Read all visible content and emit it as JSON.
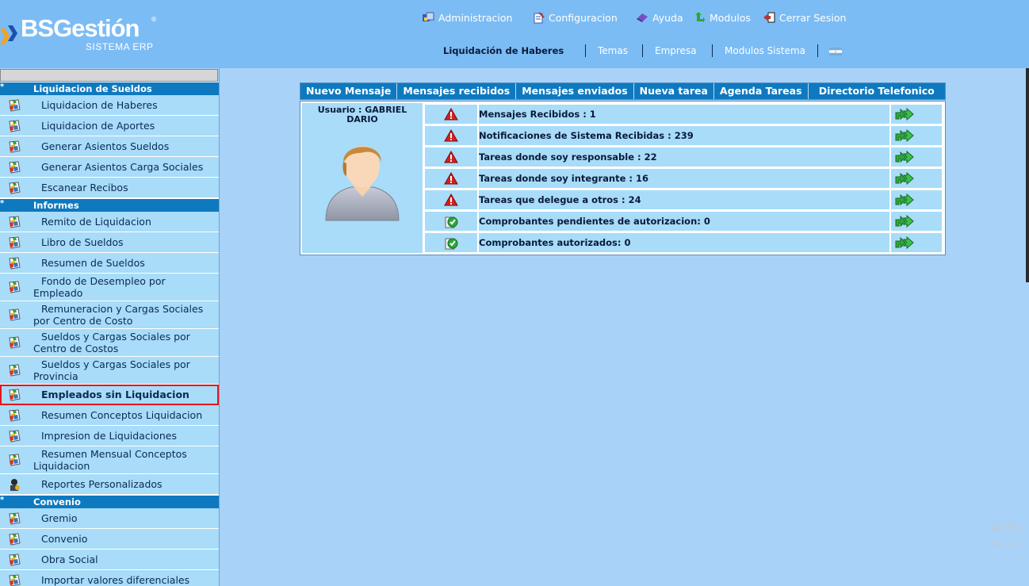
{
  "logo": {
    "brand": "BSGestión",
    "reg": "®",
    "subtitle": "SISTEMA ERP"
  },
  "topnav": [
    {
      "label": "Administracion",
      "icon": "admin-icon"
    },
    {
      "label": "Configuracion",
      "icon": "config-icon"
    },
    {
      "label": "Ayuda",
      "icon": "help-icon"
    },
    {
      "label": "Modulos",
      "icon": "modules-icon"
    },
    {
      "label": "Cerrar Sesion",
      "icon": "logout-icon"
    }
  ],
  "secnav": {
    "current": "Liquidación de Haberes",
    "links": [
      "Temas",
      "Empresa",
      "Modulos Sistema"
    ],
    "flag": "argentina-flag-icon"
  },
  "sidebar": {
    "sections": [
      {
        "title": "Liquidacion de Sueldos",
        "marker": "*"
      },
      {
        "title": "Informes",
        "marker": "*"
      },
      {
        "title": "Convenio",
        "marker": "*"
      }
    ],
    "items": [
      "Liquidacion de Haberes",
      "Liquidacion de Aportes",
      "Generar Asientos Sueldos",
      "Generar Asientos Carga Sociales",
      "Escanear Recibos",
      "Remito de Liquidacion",
      "Libro de Sueldos",
      "Resumen de Sueldos",
      "Fondo de Desempleo por Empleado",
      "Remuneracion y Cargas Sociales por Centro de Costo",
      "Sueldos y Cargas Sociales por Centro de Costos",
      "Sueldos y Cargas Sociales por Provincia",
      "Empleados sin Liquidacion",
      "Resumen Conceptos Liquidacion",
      "Impresion de Liquidaciones",
      "Resumen Mensual Conceptos Liquidacion",
      "Reportes Personalizados",
      "Gremio",
      "Convenio",
      "Obra Social",
      "Importar valores diferenciales"
    ]
  },
  "toolbar": [
    "Nuevo Mensaje",
    "Mensajes recibidos",
    "Mensajes enviados",
    "Nueva tarea",
    "Agenda Tareas",
    "Directorio Telefonico"
  ],
  "user": {
    "label": "Usuario : GABRIEL DARIO"
  },
  "rows": [
    {
      "text": "Mensajes Recibidos : 1",
      "status": "warning"
    },
    {
      "text": "Notificaciones de Sistema Recibidas : 239",
      "status": "warning"
    },
    {
      "text": "Tareas donde soy responsable : 22",
      "status": "warning"
    },
    {
      "text": "Tareas donde soy integrante : 16",
      "status": "warning"
    },
    {
      "text": "Tareas que delegue a otros : 24",
      "status": "warning"
    },
    {
      "text": "Comprobantes pendientes de autorizacion: 0",
      "status": "ok"
    },
    {
      "text": "Comprobantes autorizados: 0",
      "status": "ok"
    }
  ],
  "colors": {
    "header": "#7cbcf4",
    "section": "#0f79bf",
    "item": "#a8dcf8",
    "selected_border": "#e8141c"
  },
  "watermark": {
    "line1": "Activ",
    "line2": "Ve a C"
  }
}
